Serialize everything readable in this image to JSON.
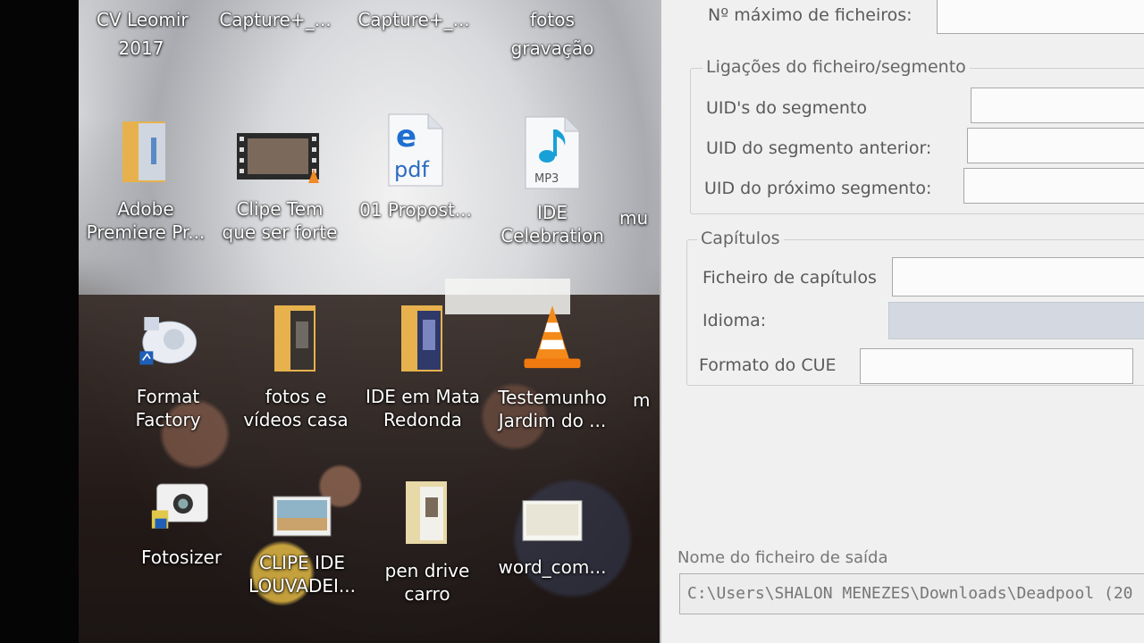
{
  "desktop": {
    "top_row": [
      {
        "label_lines": [
          "CV Leomir",
          "2017"
        ]
      },
      {
        "label_lines": [
          "Capture+_..."
        ]
      },
      {
        "label_lines": [
          "Capture+_..."
        ]
      },
      {
        "label_lines": [
          "fotos",
          "gravação"
        ]
      }
    ],
    "icons_row1": [
      {
        "name": "adobe-premiere-folder",
        "label_lines": [
          "Adobe",
          "Premiere Pr..."
        ],
        "icon": "folder-icon"
      },
      {
        "name": "clipe-tem-que-ser-forte",
        "label_lines": [
          "Clipe Tem",
          "que ser forte"
        ],
        "icon": "video-file-icon"
      },
      {
        "name": "01-proposta-pdf",
        "label_lines": [
          "01 Propost..."
        ],
        "icon": "pdf-icon",
        "pdf_text": "pdf"
      },
      {
        "name": "ide-celebration-mp3",
        "label_lines": [
          "IDE",
          "Celebration"
        ],
        "icon": "mp3-icon",
        "mp3_text": "MP3"
      },
      {
        "name": "mu-partial",
        "label_lines": [
          "mu"
        ]
      }
    ],
    "icons_row2": [
      {
        "name": "format-factory",
        "label_lines": [
          "Format",
          "Factory"
        ],
        "icon": "format-factory-icon"
      },
      {
        "name": "fotos-e-videos-casa",
        "label_lines": [
          "fotos e",
          "vídeos casa"
        ],
        "icon": "folder-icon"
      },
      {
        "name": "ide-em-mata-redonda",
        "label_lines": [
          "IDE em Mata",
          "Redonda"
        ],
        "icon": "folder-icon"
      },
      {
        "name": "testemunho-jardim",
        "label_lines": [
          "Testemunho",
          "Jardim do ..."
        ],
        "icon": "vlc-cone-icon"
      },
      {
        "name": "m-partial",
        "label_lines": [
          "m"
        ]
      }
    ],
    "icons_row3": [
      {
        "name": "fotosizer",
        "label_lines": [
          "Fotosizer"
        ],
        "icon": "camera-icon"
      },
      {
        "name": "clipe-ide-louvadei",
        "label_lines": [
          "CLIPE IDE",
          "LOUVADEI..."
        ],
        "icon": "image-file-icon"
      },
      {
        "name": "pen-drive-carro",
        "label_lines": [
          "pen drive",
          "carro"
        ],
        "icon": "folder-icon"
      },
      {
        "name": "word-com",
        "label_lines": [
          "word_com..."
        ],
        "icon": "image-file-icon"
      }
    ]
  },
  "panel": {
    "max_files_label": "Nº máximo de ficheiros:",
    "links_group_title": "Ligações do ficheiro/segmento",
    "segment_uids_label": "UID's do segmento",
    "prev_segment_uid_label": "UID do segmento anterior:",
    "next_segment_uid_label": "UID do próximo segmento:",
    "chapters_group_title": "Capítulos",
    "chapters_file_label": "Ficheiro de capítulos",
    "language_label": "Idioma:",
    "cue_format_label": "Formato do CUE",
    "output_file_label": "Nome do ficheiro de saída",
    "output_file_value": "C:\\Users\\SHALON MENEZES\\Downloads\\Deadpool (20",
    "colors": {
      "panel_bg": "#f0f0f0",
      "field_bg": "#fbfbfb",
      "disabled_field": "#d4d8e0"
    }
  }
}
